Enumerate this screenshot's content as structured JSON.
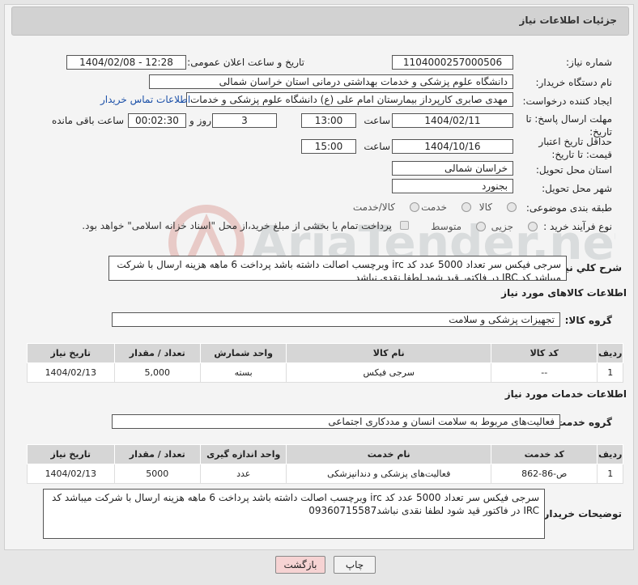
{
  "header": {
    "title": "جزئیات اطلاعات نیاز"
  },
  "fields": {
    "need_number": {
      "label": "شماره نیاز:",
      "value": "1104000257000506"
    },
    "announce": {
      "label": "تاریخ و ساعت اعلان عمومی:",
      "value": "1404/02/08 - 12:28"
    },
    "buyer": {
      "label": "نام دستگاه خریدار:",
      "value": "دانشگاه علوم پزشکی و خدمات بهداشتی درمانی استان خراسان شمالی"
    },
    "creator": {
      "label": "ایجاد کننده درخواست:",
      "value": "مهدی صابری کارپرداز بیمارستان امام علی (ع) دانشگاه علوم پزشکی و خدمات ب",
      "contact_link": "اطلاعات تماس خریدار"
    },
    "deadline": {
      "label": "مهلت ارسال پاسخ: تا تاریخ:",
      "date": "1404/02/11",
      "time_label": "ساعت",
      "time": "13:00",
      "days": "3",
      "days_label": "روز و",
      "remaining": "00:02:30",
      "remaining_label": "ساعت باقی مانده"
    },
    "validity": {
      "label": "حداقل تاریخ اعتبار قیمت: تا تاریخ:",
      "date": "1404/10/16",
      "time_label": "ساعت",
      "time": "15:00"
    },
    "province": {
      "label": "استان محل تحویل:",
      "value": "خراسان شمالی"
    },
    "city": {
      "label": "شهر محل تحویل:",
      "value": "بجنورد"
    },
    "category": {
      "label": "طبقه بندی موضوعی:",
      "options": [
        "کالا",
        "خدمت",
        "کالا/خدمت"
      ]
    },
    "process": {
      "label": "نوع فرآیند خرید :",
      "options": [
        "جزیی",
        "متوسط"
      ],
      "note": "پرداخت تمام یا بخشی از مبلغ خرید،از محل \"اسناد خزانه اسلامی\" خواهد بود."
    }
  },
  "general_desc": {
    "label": "شرح کلي نياز:",
    "text": "سرجی فیکس سر تعداد 5000 عدد کد irc وبرچسب اصالت داشته باشد پرداخت 6 ماهه هزینه ارسال با شرکت میباشد کد IRC در فاکتور قید شود لطفا نقدی نباشد"
  },
  "goods": {
    "section_title": "اطلاعات کالاهای مورد نیاز",
    "group_label": "گروه کالا:",
    "group_value": "تجهیزات پزشکی و سلامت",
    "columns": [
      "ردیف",
      "کد کالا",
      "نام کالا",
      "واحد شمارش",
      "تعداد / مقدار",
      "تاریخ نیاز"
    ],
    "rows": [
      [
        "1",
        "--",
        "سرجی فیکس",
        "بسته",
        "5,000",
        "1404/02/13"
      ]
    ]
  },
  "services": {
    "section_title": "اطلاعات خدمات مورد نیاز",
    "group_label": "گروه خدمت:",
    "group_value": "فعالیت‌های مربوط به سلامت انسان و مددکاری اجتماعی",
    "columns": [
      "ردیف",
      "کد خدمت",
      "نام خدمت",
      "واحد اندازه گیری",
      "تعداد / مقدار",
      "تاریخ نیاز"
    ],
    "rows": [
      [
        "1",
        "ص-86-862",
        "فعالیت‌های پزشکی و دندانپزشکی",
        "عدد",
        "5000",
        "1404/02/13"
      ]
    ]
  },
  "buyer_notes": {
    "label": "توضیحات خریدار:",
    "text": "سرجی فیکس سر تعداد 5000 عدد کد irc وبرچسب اصالت داشته باشد پرداخت 6 ماهه هزینه ارسال با شرکت میباشد کد IRC در فاکتور قید شود لطفا نقدی نباشد09360715587"
  },
  "buttons": {
    "print": "چاپ",
    "back": "بازگشت"
  },
  "watermark": {
    "text": "AriaTender.net"
  },
  "colors": {
    "back_button": "#f6d3d3",
    "print_button": "#f2f2f2",
    "link": "#1a4fa8",
    "header": "#d2d2d2"
  }
}
